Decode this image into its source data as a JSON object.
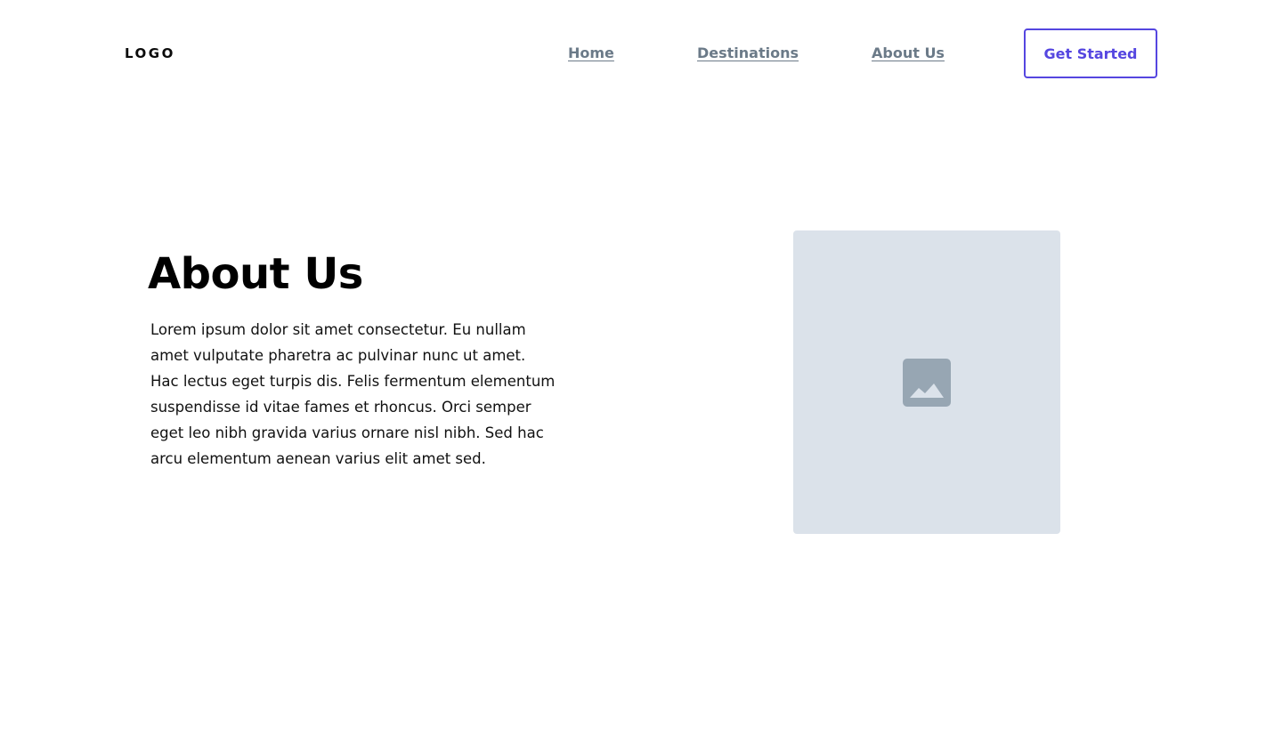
{
  "header": {
    "logo": "LOGO",
    "nav": {
      "home": "Home",
      "destinations": "Destinations",
      "about": "About Us"
    },
    "cta_label": "Get Started"
  },
  "main": {
    "title": "About Us",
    "body": "Lorem ipsum dolor sit amet consectetur. Eu nullam amet vulputate pharetra ac pulvinar nunc ut amet. Hac lectus eget turpis dis. Felis fermentum elementum suspendisse id vitae fames et rhoncus. Orci semper eget leo nibh gravida varius ornare nisl nibh. Sed hac arcu elementum aenean varius elit amet sed.",
    "image_icon": "image-placeholder-icon"
  },
  "colors": {
    "accent": "#5546e0",
    "nav_text": "#6b7a88",
    "placeholder_bg": "#dbe2ea",
    "placeholder_icon": "#97a6b3"
  }
}
